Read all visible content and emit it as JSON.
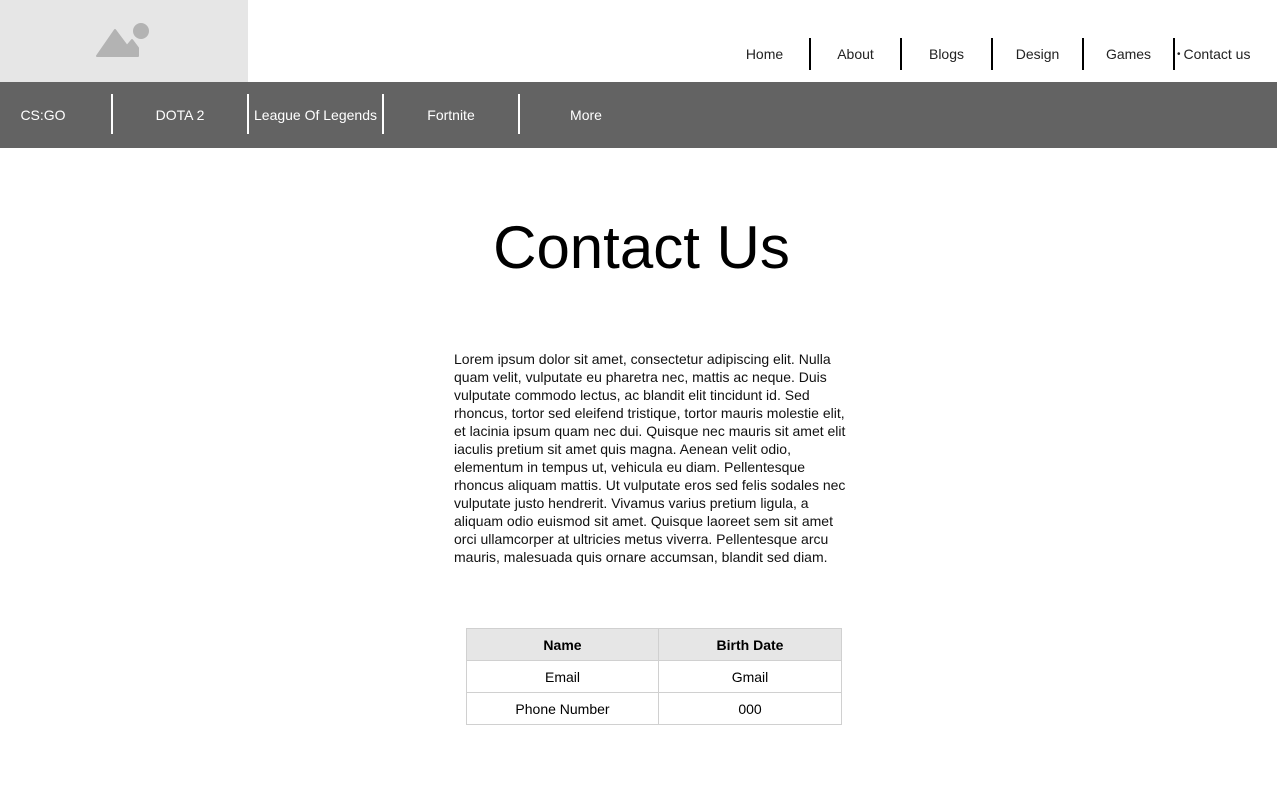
{
  "header": {
    "logo_icon": "image-placeholder-icon",
    "nav": [
      {
        "label": "Home"
      },
      {
        "label": "About"
      },
      {
        "label": "Blogs"
      },
      {
        "label": "Design"
      },
      {
        "label": "Games"
      },
      {
        "label": "Contact us",
        "active": true
      }
    ],
    "active_marker": "•"
  },
  "subnav": {
    "items": [
      {
        "label": "CS:GO"
      },
      {
        "label": "DOTA 2"
      },
      {
        "label": "League Of Legends"
      },
      {
        "label": "Fortnite"
      },
      {
        "label": "More"
      }
    ]
  },
  "main": {
    "title": "Contact Us",
    "paragraph": "Lorem ipsum dolor sit amet, consectetur adipiscing elit. Nulla quam velit, vulputate eu pharetra nec, mattis ac neque. Duis vulputate commodo lectus, ac blandit elit tincidunt id. Sed rhoncus, tortor sed eleifend tristique, tortor mauris molestie elit, et lacinia ipsum quam nec dui. Quisque nec mauris sit amet elit iaculis pretium sit amet quis magna. Aenean velit odio, elementum in tempus ut, vehicula eu diam. Pellentesque rhoncus aliquam mattis. Ut vulputate eros sed felis sodales nec vulputate justo hendrerit. Vivamus varius pretium ligula, a aliquam odio euismod sit amet. Quisque laoreet sem sit amet orci ullamcorper at ultricies metus viverra. Pellentesque arcu mauris, malesuada quis ornare accumsan, blandit sed diam.",
    "table": {
      "headers": [
        "Name",
        "Birth Date"
      ],
      "rows": [
        [
          "Email",
          "Gmail"
        ],
        [
          "Phone Number",
          "000"
        ]
      ]
    }
  },
  "colors": {
    "subnav_bg": "#636363",
    "logo_bg": "#e6e6e6",
    "table_header_bg": "#e6e6e6"
  }
}
